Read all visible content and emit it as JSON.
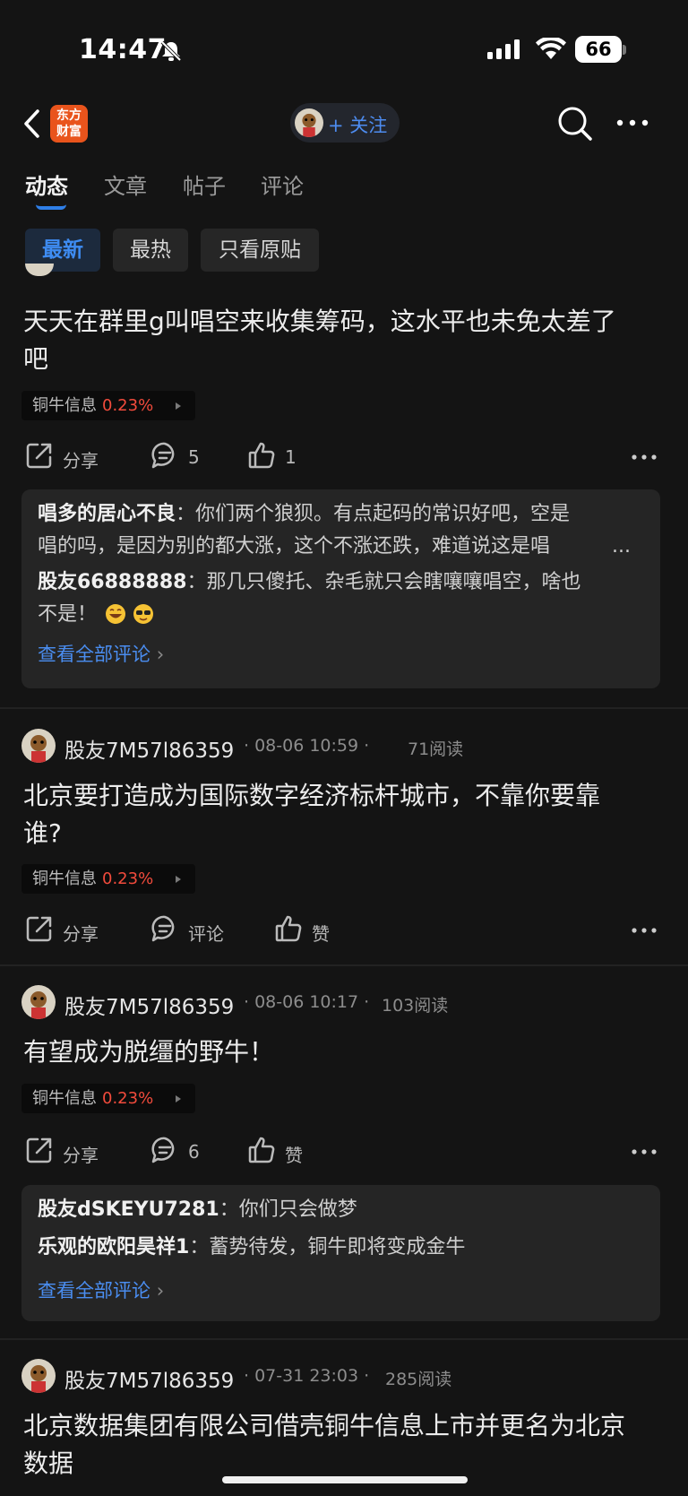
{
  "status_bar": {
    "time": "14:47",
    "battery": "66"
  },
  "nav": {
    "logo_line1": "东方",
    "logo_line2": "财富",
    "follow_label": "+ 关注"
  },
  "tabs": [
    {
      "label": "动态",
      "active": true
    },
    {
      "label": "文章",
      "active": false
    },
    {
      "label": "帖子",
      "active": false
    },
    {
      "label": "评论",
      "active": false
    }
  ],
  "filters": [
    {
      "label": "最新",
      "active": true
    },
    {
      "label": "最热",
      "active": false
    },
    {
      "label": "只看原贴",
      "active": false
    }
  ],
  "posts": [
    {
      "text_line1": "天天在群里g叫唱空来收集筹码，这水平也未免太差了",
      "text_line2": "吧",
      "stock_name": "铜牛信息",
      "stock_pct": "0.23%",
      "share_label": "分享",
      "comment_label": "5",
      "like_label": "1",
      "comments": [
        {
          "author": "唱多的居心不良",
          "sep": "：",
          "text_line1": "你们两个狼狈。有点起码的常识好吧，空是",
          "text_line2": "唱的吗，是因为别的都大涨，这个不涨还跌，难道说这是唱",
          "ellipsis": "..."
        },
        {
          "author": "股友66888888",
          "sep": "：",
          "text_line1": "那几只傻托、杂毛就只会瞎嚷嚷唱空，啥也",
          "text_line2": "不是！"
        }
      ],
      "see_all": "查看全部评论"
    },
    {
      "username": "股友7M57l86359",
      "meta_time": "· 08-06 10:59 ·",
      "meta_reads": "71阅读",
      "text_line1": "北京要打造成为国际数字经济标杆城市，不靠你要靠",
      "text_line2": "谁?",
      "stock_name": "铜牛信息",
      "stock_pct": "0.23%",
      "share_label": "分享",
      "comment_label": "评论",
      "like_label": "赞"
    },
    {
      "username": "股友7M57l86359",
      "meta_time": "· 08-06 10:17 ·",
      "meta_reads": "103阅读",
      "text_line1": "有望成为脱缰的野牛！",
      "stock_name": "铜牛信息",
      "stock_pct": "0.23%",
      "share_label": "分享",
      "comment_label": "6",
      "like_label": "赞",
      "comments": [
        {
          "author": "股友dSKEYU7281",
          "sep": "：",
          "text_line1": "你们只会做梦"
        },
        {
          "author": "乐观的欧阳昊祥1",
          "sep": "：",
          "text_line1": "蓄势待发，铜牛即将变成金牛"
        }
      ],
      "see_all": "查看全部评论"
    },
    {
      "username": "股友7M57l86359",
      "meta_time": "· 07-31 23:03 ·",
      "meta_reads": "285阅读",
      "text_line1": "北京数据集团有限公司借壳铜牛信息上市并更名为北京",
      "text_line2": "数据"
    }
  ],
  "colors": {
    "accent": "#3e8cf2",
    "up_red": "#f24b3c",
    "brand_orange": "#e9541c"
  }
}
